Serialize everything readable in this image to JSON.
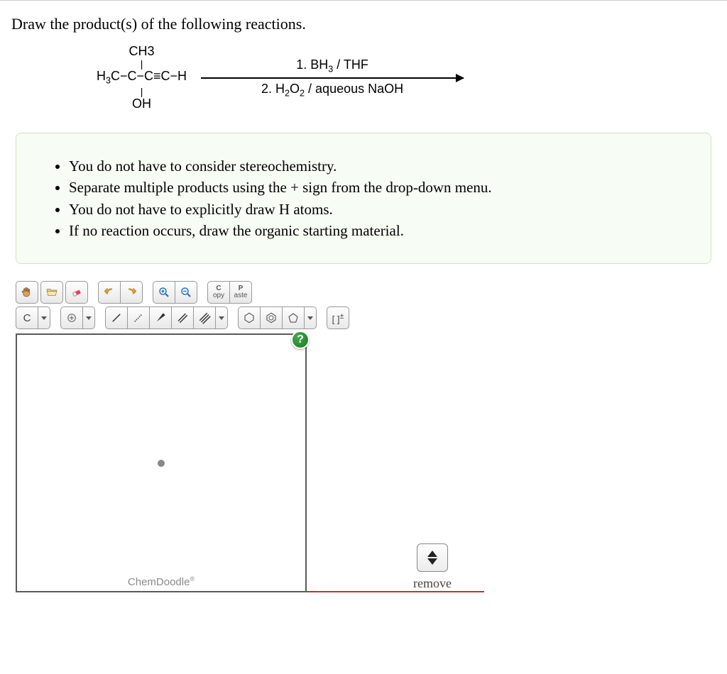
{
  "question": {
    "prompt": "Draw the product(s) of the following reactions."
  },
  "reaction": {
    "structure_top": "CH3",
    "structure_mid_prefix": "H",
    "structure_mid_formula": "3C-C-C≡C-H",
    "structure_bot": "OH",
    "condition_top_label": "1. BH",
    "condition_top_sub": "3",
    "condition_top_suffix": " / THF",
    "condition_bot_prefix": "2. H",
    "condition_bot_sub1": "2",
    "condition_bot_mid": "O",
    "condition_bot_sub2": "2",
    "condition_bot_suffix": " / aqueous NaOH"
  },
  "instructions": [
    "You do not have to consider stereochemistry.",
    "Separate multiple products using the + sign from the drop-down menu.",
    "You do not have to explicitly draw H atoms.",
    "If no reaction occurs, draw the organic starting material."
  ],
  "toolbar": {
    "copy_top": "C",
    "copy_bot": "opy",
    "paste_top": "P",
    "paste_bot": "aste",
    "element_label": "C",
    "charge_label": "[ ]",
    "charge_sup": "±"
  },
  "canvas": {
    "help": "?",
    "brand": "ChemDoodle",
    "brand_mark": "®"
  },
  "footer": {
    "remove": "remove"
  }
}
